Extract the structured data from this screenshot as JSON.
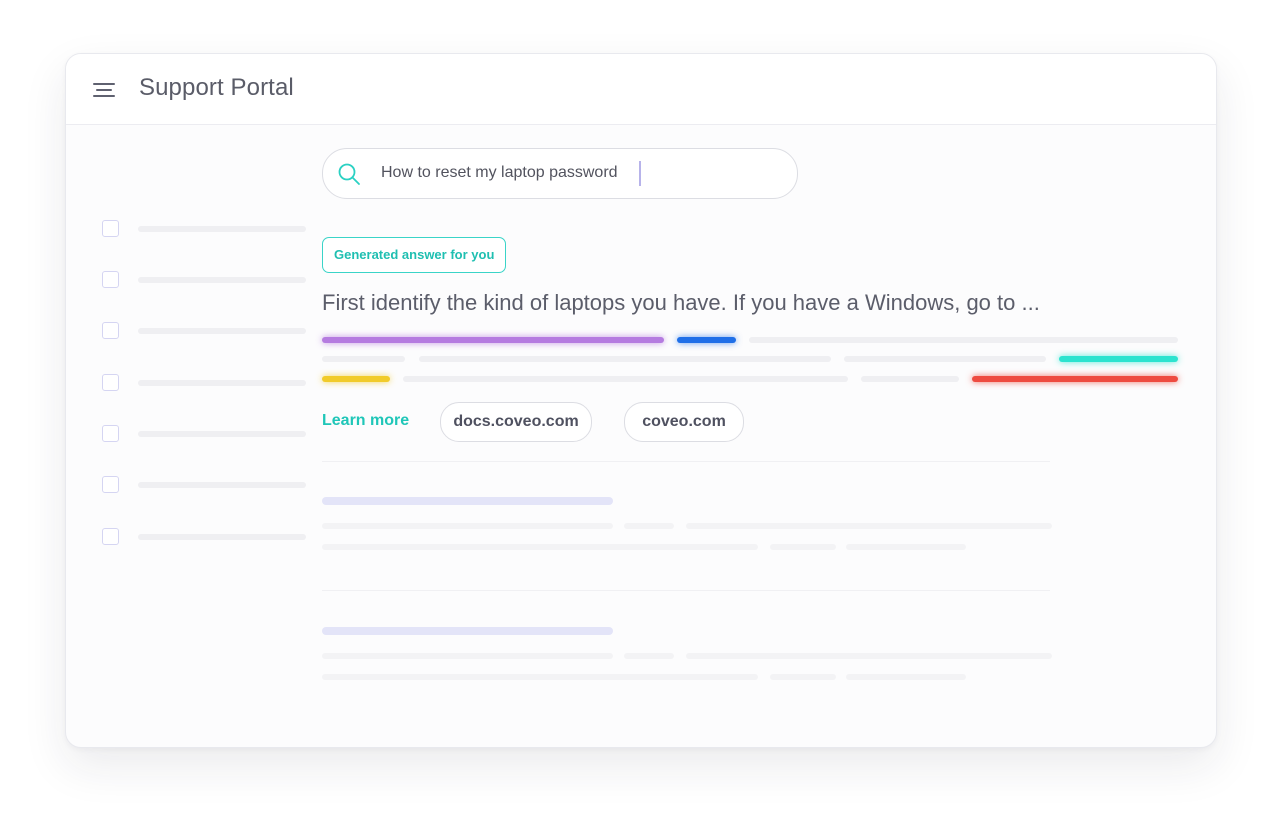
{
  "header": {
    "title": "Support Portal",
    "menu_icon": "hamburger-menu-icon"
  },
  "search": {
    "value": "How to reset my laptop password",
    "icon": "search-icon",
    "accent_color": "#2ad1c3"
  },
  "facets": {
    "count": 7
  },
  "generated_answer": {
    "badge_label": "Generated answer for you",
    "text": "First identify the kind of laptops you have. If you have a Windows, go to ...",
    "citation_colors": [
      "#b57be0",
      "#1f6fe8",
      "#2ce3cf",
      "#f1cb2a",
      "#ee4b40"
    ]
  },
  "sources": {
    "learn_more_label": "Learn more",
    "chips": [
      "docs.coveo.com",
      "coveo.com"
    ]
  },
  "colors": {
    "accent": "#1fc6b8",
    "text": "#5b5d6a"
  }
}
